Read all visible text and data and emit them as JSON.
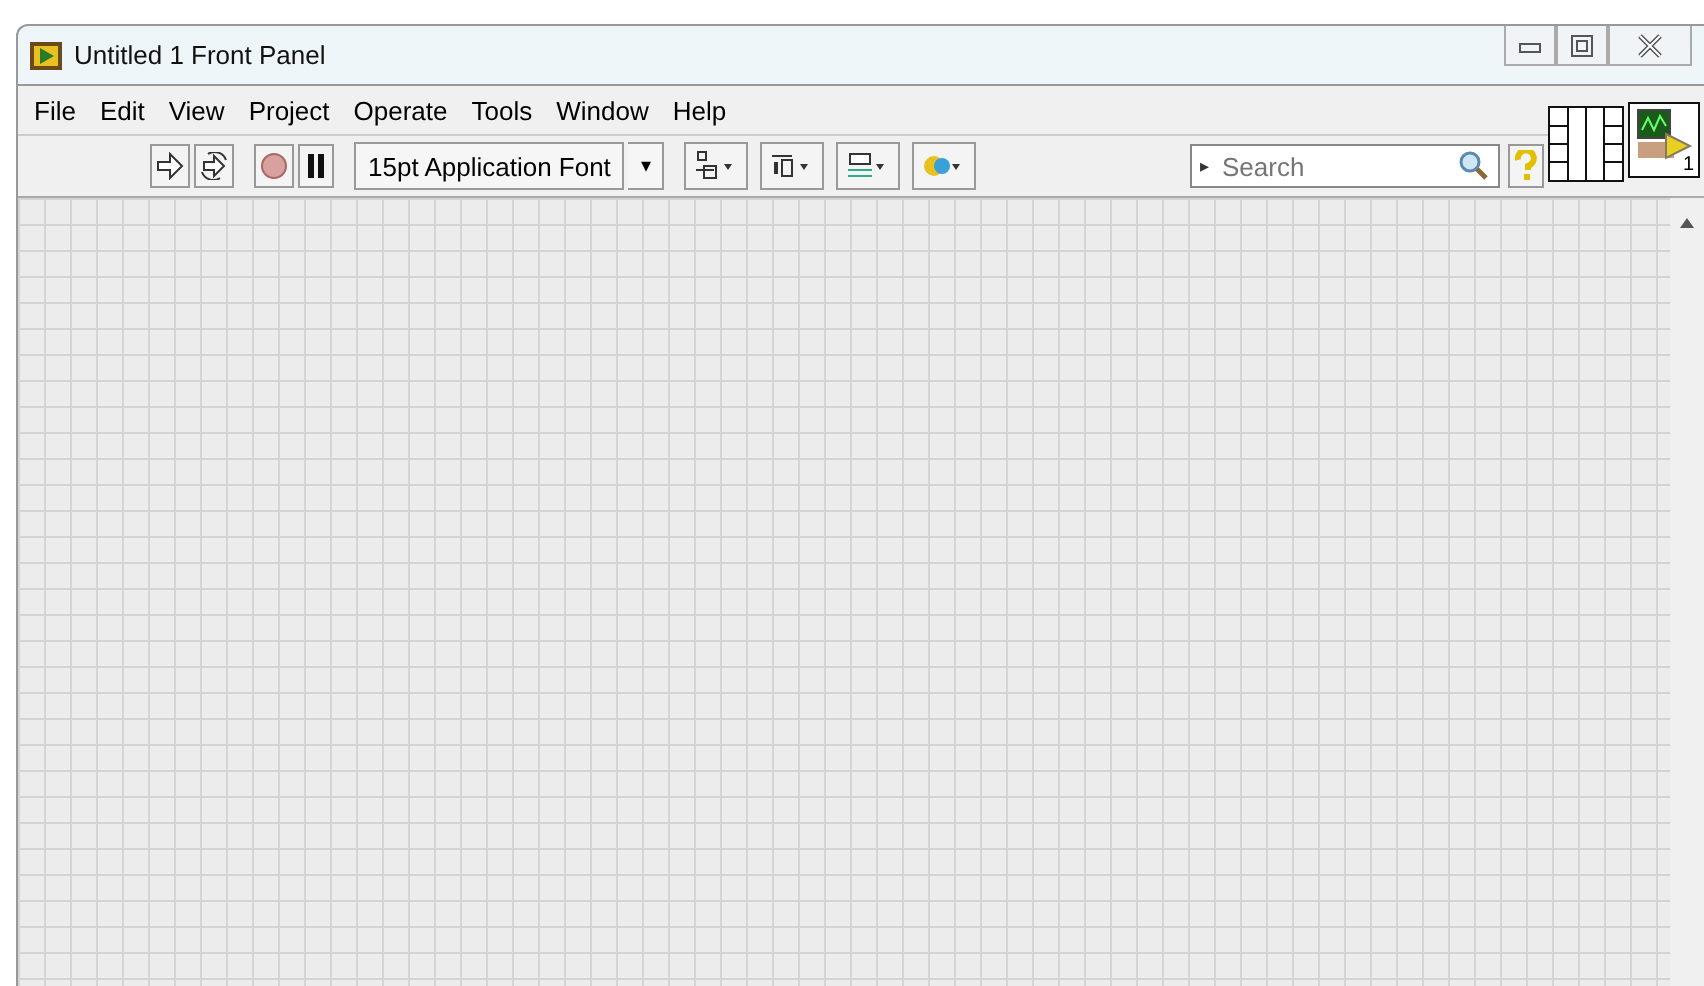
{
  "window": {
    "title": "Untitled 1 Front Panel"
  },
  "menu": [
    "File",
    "Edit",
    "View",
    "Project",
    "Operate",
    "Tools",
    "Window",
    "Help"
  ],
  "toolbar": {
    "font": "15pt Application Font",
    "font_caret": "▾"
  },
  "search": {
    "placeholder": "Search",
    "arrow": "▸"
  },
  "vi_icon": {
    "label": "1"
  }
}
